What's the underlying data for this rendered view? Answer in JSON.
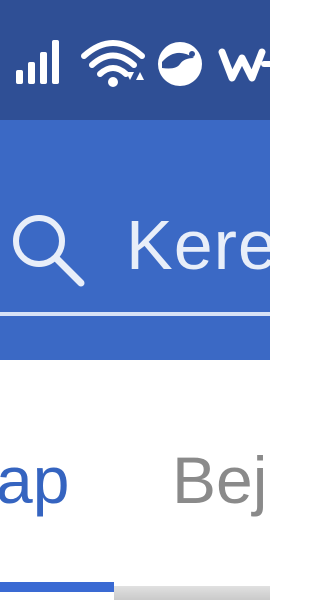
{
  "status_bar": {
    "icons": [
      "signal-icon",
      "wifi-icon",
      "app-icon",
      "app-icon"
    ],
    "background": "#2f4f95"
  },
  "app_bar": {
    "background": "#3b69c5",
    "search": {
      "placeholder": "Kere"
    }
  },
  "tabs": {
    "items": [
      {
        "label": "ap",
        "active": true
      },
      {
        "label": "Bej",
        "active": false
      }
    ],
    "active_color": "#3564c0",
    "inactive_color": "#8a8a8a"
  }
}
